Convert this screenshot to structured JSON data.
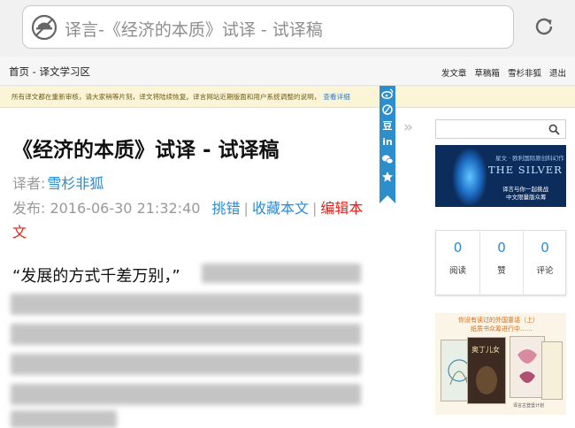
{
  "browser": {
    "url_title": "译言-《经济的本质》试译 - 试译稿"
  },
  "nav": {
    "breadcrumb": "首页 - 译文学习区",
    "links": [
      "发文章",
      "草稿箱",
      "雪杉非狐",
      "退出"
    ]
  },
  "notice": {
    "text": "所有译文都在重新审核，请大家稍等片刻，译文将陆续恢复。译言网站近期版面和用户系统调整的说明，",
    "link": "查看详细"
  },
  "share": {
    "icons": [
      "weibo-icon",
      "qzone-icon",
      "douban-icon",
      "linkedin-icon",
      "wechat-icon",
      "favorite-star-icon"
    ],
    "douban_glyph": "豆",
    "linkedin_glyph": "in"
  },
  "article": {
    "title": "《经济的本质》试译 - 试译稿",
    "translator_label": "译者:",
    "translator": "雪杉非狐",
    "published_label": "发布:",
    "published": "2016-06-30 21:32:40",
    "actions": {
      "report": "挑错",
      "sep": "|",
      "favorite": "收藏本文",
      "edit": "编辑本文"
    },
    "lead": "“发展的方式千差万别，”"
  },
  "sidebar": {
    "ad_top": {
      "headline": "THE SILVER CORD",
      "small": "星文 · 欧利国际原创科幻作",
      "line1": "译言与你一起挑战",
      "line2": "中文限量版众筹"
    },
    "stats": [
      {
        "value": "0",
        "label": "阅读"
      },
      {
        "value": "0",
        "label": "赞"
      },
      {
        "value": "0",
        "label": "评论"
      }
    ],
    "ad_bottom": {
      "line1": "你没有读过的外国童话（上）",
      "line2": "纸质书众筹进行中……",
      "book_title": "奥丁儿女",
      "publisher": "译言古登堡计划"
    }
  }
}
